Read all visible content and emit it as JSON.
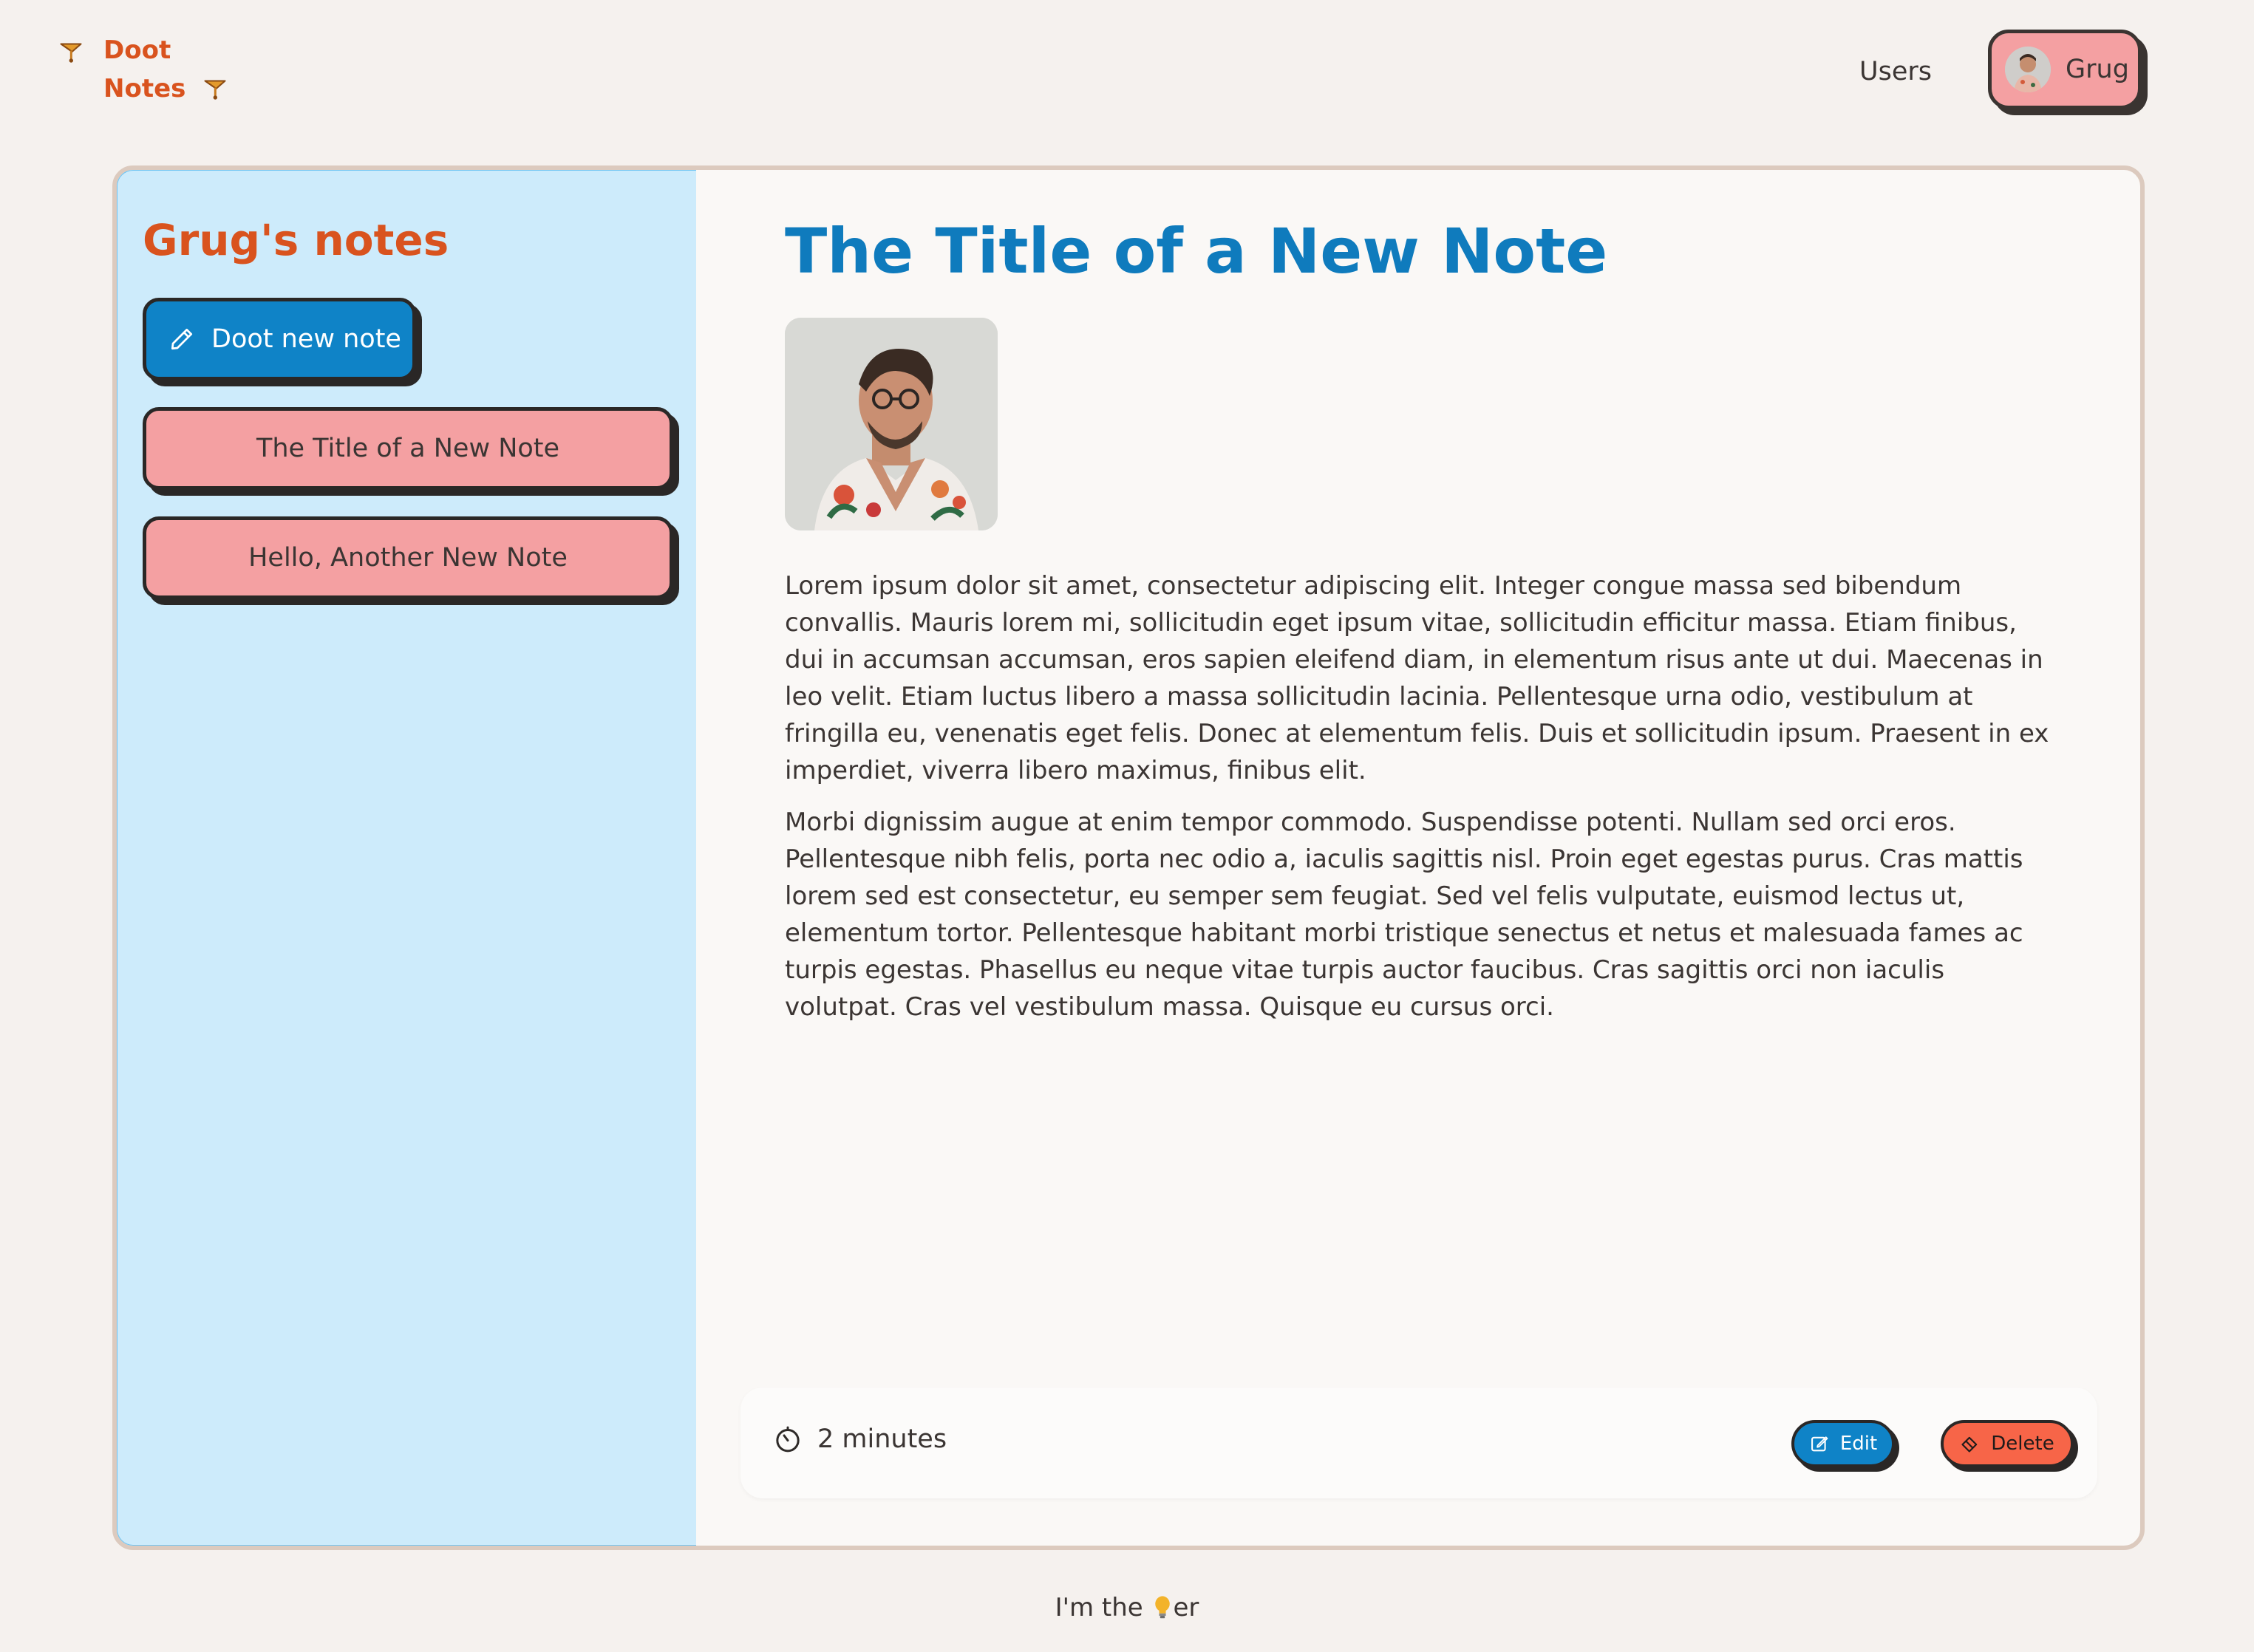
{
  "header": {
    "logo_line1": "Doot",
    "logo_line2": "Notes",
    "users_link": "Users",
    "user_name": "Grug"
  },
  "sidebar": {
    "title": "Grug's notes",
    "new_note_label": "Doot new note",
    "notes": [
      {
        "label": "The Title of a New Note"
      },
      {
        "label": "Hello, Another New Note"
      }
    ]
  },
  "note": {
    "title": "The Title of a New Note",
    "paragraphs": [
      "Lorem ipsum dolor sit amet, consectetur adipiscing elit. Integer congue massa sed bibendum convallis. Mauris lorem mi, sollicitudin eget ipsum vitae, sollicitudin efficitur massa. Etiam finibus, dui in accumsan accumsan, eros sapien eleifend diam, in elementum risus ante ut dui. Maecenas in leo velit. Etiam luctus libero a massa sollicitudin lacinia. Pellentesque urna odio, vestibulum at fringilla eu, venenatis eget felis. Donec at elementum felis. Duis et sollicitudin ipsum. Praesent in ex imperdiet, viverra libero maximus, finibus elit.",
      "Morbi dignissim augue at enim tempor commodo. Suspendisse potenti. Nullam sed orci eros. Pellentesque nibh felis, porta nec odio a, iaculis sagittis nisl. Proin eget egestas purus. Cras mattis lorem sed est consectetur, eu semper sem feugiat. Sed vel felis vulputate, euismod lectus ut, elementum tortor. Pellentesque habitant morbi tristique senectus et netus et malesuada fames ac turpis egestas. Phasellus eu neque vitae turpis auctor faucibus. Cras sagittis orci non iaculis volutpat. Cras vel vestibulum massa. Quisque eu cursus orci."
    ],
    "updated": "2 minutes",
    "edit_label": "Edit",
    "delete_label": "Delete"
  },
  "footer": {
    "tagline_before": "I'm the ",
    "tagline_after": "er"
  },
  "colors": {
    "brand_orange": "#d9531e",
    "primary_blue": "#0f83c7",
    "pink": "#f4a0a2",
    "danger": "#f76548",
    "sidebar_bg": "#cdebfb"
  },
  "icons": {
    "logo": "trumpet-icon",
    "new_note": "pencil-icon",
    "time": "timer-icon",
    "edit": "edit-icon",
    "delete": "eraser-icon",
    "tagline": "lightbulb-icon"
  }
}
